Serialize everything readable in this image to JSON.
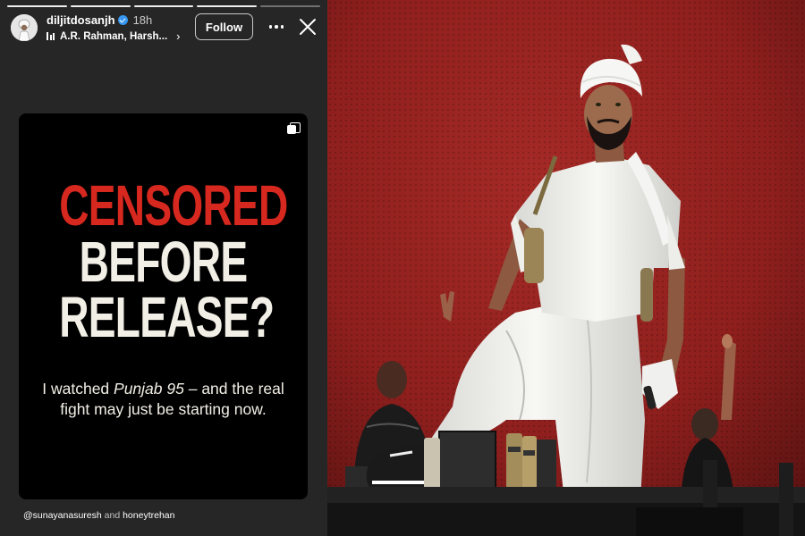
{
  "story": {
    "username": "diljitdosanjh",
    "time_ago": "18h",
    "music": "A.R. Rahman, Harsh...",
    "follow_label": "Follow",
    "progress": {
      "segments": 5,
      "completed": 4
    },
    "card": {
      "headline_line1": "CENSORED",
      "headline_line2": "BEFORE",
      "headline_line3": "RELEASE?",
      "sub_prefix": "I watched ",
      "sub_emphasis": "Punjab 95",
      "sub_suffix": " – and the real fight may just be starting now."
    },
    "mention_1": "@sunayanasuresh",
    "mention_and": "and",
    "mention_2": "honeytrehan"
  },
  "colors": {
    "panel_bg": "#262626",
    "headline_red": "#d6281f",
    "headline_cream": "#f2efe6",
    "stage_red": "#8e1f1d"
  },
  "photo": {
    "subject": "performer in white turban and kurta on concert stage with red backdrop"
  }
}
